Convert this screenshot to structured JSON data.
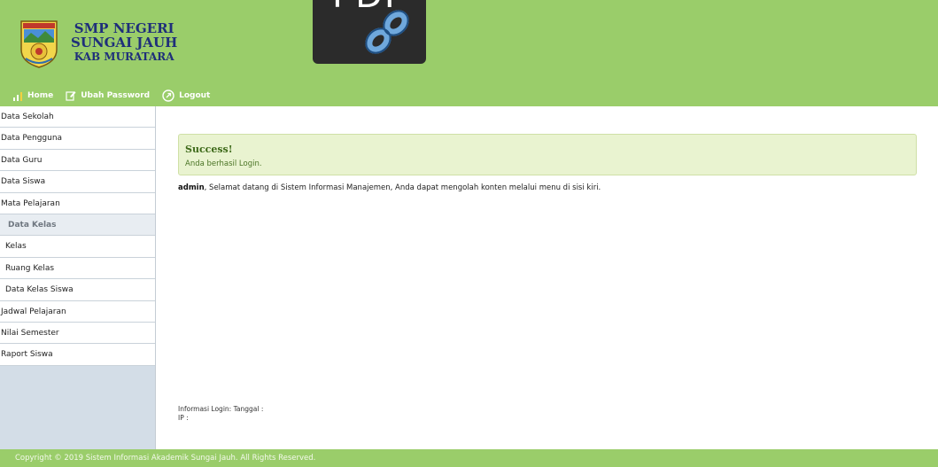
{
  "header": {
    "school_line1": "SMP NEGERI",
    "school_line2": "SUNGAI JAUH",
    "school_line3": "KAB MURATARA",
    "pdf_badge": "PDF"
  },
  "nav": {
    "home": "Home",
    "change_password": "Ubah Password",
    "logout": "Logout"
  },
  "sidebar": {
    "items": [
      {
        "label": "Data Sekolah"
      },
      {
        "label": "Data Pengguna"
      },
      {
        "label": "Data Guru"
      },
      {
        "label": "Data Siswa"
      },
      {
        "label": "Mata Pelajaran"
      }
    ],
    "group_label": "Data Kelas",
    "sub_items": [
      {
        "label": "Kelas"
      },
      {
        "label": "Ruang Kelas"
      },
      {
        "label": "Data Kelas Siswa"
      }
    ],
    "items_after": [
      {
        "label": "Jadwal Pelajaran"
      },
      {
        "label": "Nilai Semester"
      },
      {
        "label": "Raport Siswa"
      }
    ]
  },
  "main": {
    "alert_title": "Success!",
    "alert_message": "Anda berhasil Login.",
    "welcome_user": "admin",
    "welcome_text": ", Selamat datang di Sistem Informasi Manajemen, Anda dapat mengolah konten melalui menu di sisi kiri.",
    "login_info_label": "Informasi Login: Tanggal :",
    "ip_label": "IP :"
  },
  "footer": {
    "copyright": "Copyright © 2019 Sistem Informasi Akademik Sungai Jauh. All Rights Reserved."
  },
  "colors": {
    "header_green": "#9acd6a",
    "sidebar_bg": "#d3dde7",
    "alert_bg": "#e9f3d0",
    "school_name": "#1f2f7a"
  }
}
